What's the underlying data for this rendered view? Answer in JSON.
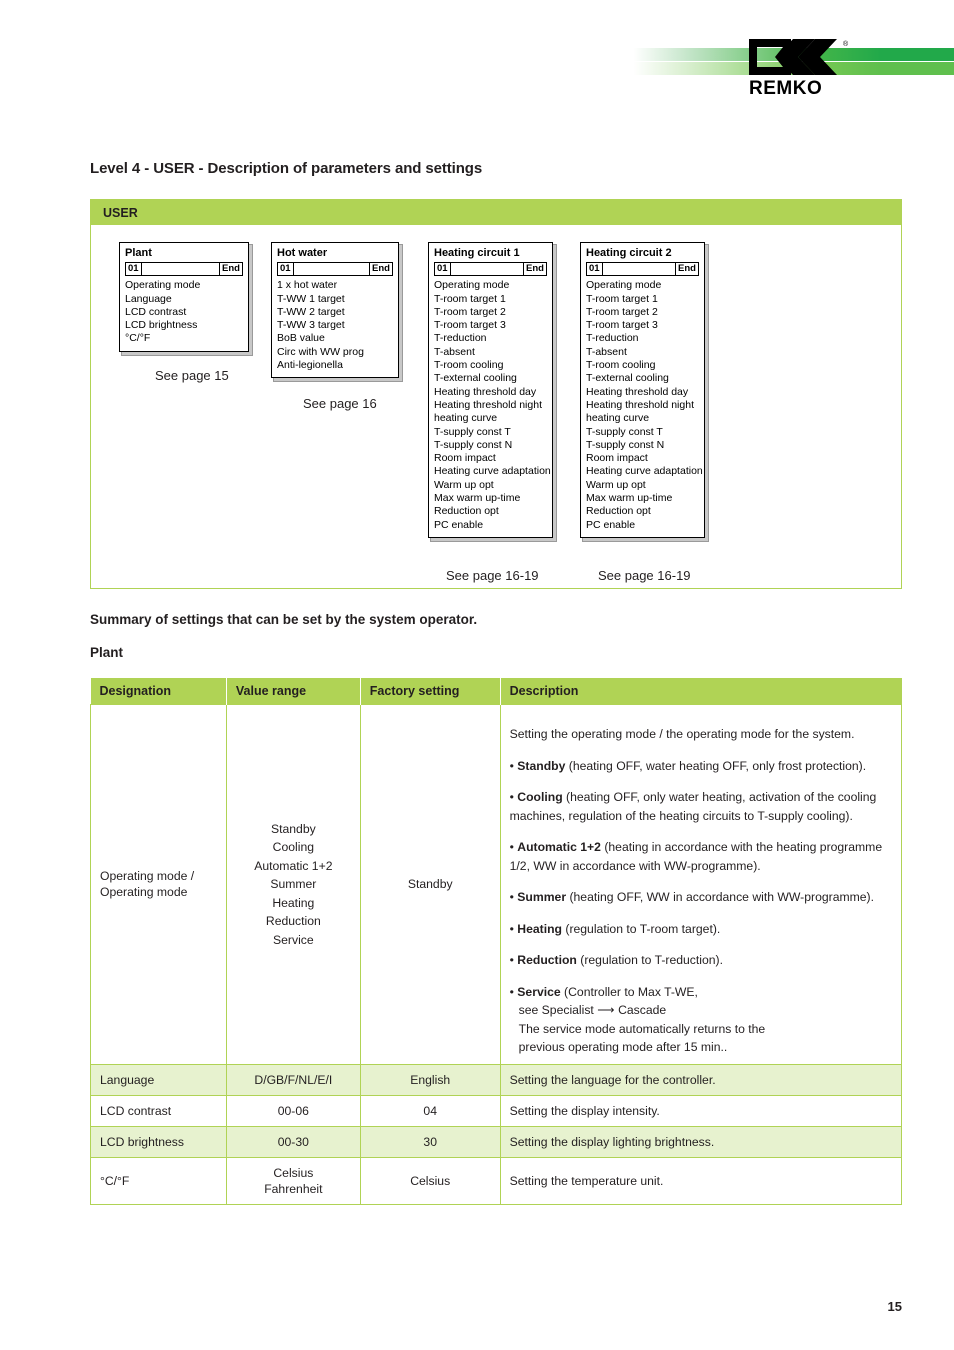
{
  "brand": {
    "name": "REMKO",
    "registered": "®",
    "accent_green": "#b0d355",
    "bar_green_dark": "#22a94a",
    "bar_green_light": "#5fbf4d"
  },
  "section": {
    "title": "Level 4 - USER - Description of parameters and settings"
  },
  "diagram": {
    "panel_label": "USER",
    "boxes": [
      {
        "title": "Plant",
        "index": "01",
        "end": "End",
        "items": [
          "Operating mode",
          "Language",
          "LCD contrast",
          "LCD brightness",
          "°C/°F"
        ],
        "caption": "See page 15"
      },
      {
        "title": "Hot water",
        "index": "01",
        "end": "End",
        "items": [
          "1 x hot water",
          "T-WW 1 target",
          "T-WW 2 target",
          "T-WW 3 target",
          "BoB value",
          "Circ with WW prog",
          "Anti-legionella"
        ],
        "caption": "See page 16"
      },
      {
        "title": "Heating circuit 1",
        "index": "01",
        "end": "End",
        "items": [
          "Operating mode",
          "T-room target 1",
          "T-room target 2",
          "T-room target 3",
          "T-reduction",
          "T-absent",
          "T-room cooling",
          "T-external cooling",
          "Heating threshold day",
          "Heating threshold night",
          "heating curve",
          "T-supply const T",
          "T-supply const N",
          "Room impact",
          "Heating curve adaptation",
          "Warm up opt",
          "Max warm up-time",
          "Reduction opt",
          "PC enable"
        ],
        "caption": "See page 16-19"
      },
      {
        "title": "Heating circuit 2",
        "index": "01",
        "end": "End",
        "items": [
          "Operating mode",
          "T-room target 1",
          "T-room target 2",
          "T-room target 3",
          "T-reduction",
          "T-absent",
          "T-room cooling",
          "T-external cooling",
          "Heating threshold day",
          "Heating threshold night",
          "heating curve",
          "T-supply const T",
          "T-supply const N",
          "Room impact",
          "Heating curve adaptation",
          "Warm up opt",
          "Max warm up-time",
          "Reduction opt",
          "PC enable"
        ],
        "caption": "See page 16-19"
      }
    ]
  },
  "summary_line": "Summary of settings that can be set by the system operator.",
  "plant_line": "Plant",
  "table": {
    "headers": {
      "designation": "Designation",
      "value_range": "Value range",
      "factory_setting": "Factory setting",
      "description": "Description"
    },
    "operating_mode_row": {
      "designation": "Operating mode /\nOperating mode",
      "designation_l1": "Operating mode /",
      "designation_l2": "Operating mode",
      "value_range": [
        "Standby",
        "Cooling",
        "Automatic 1+2",
        "Summer",
        "Heating",
        "Reduction",
        "Service"
      ],
      "factory_setting": "Standby",
      "description": {
        "intro": "Setting the operating mode / the operating mode for the system.",
        "bullets": [
          {
            "bullet": "•",
            "term": "Standby",
            "text": " (heating OFF, water heating OFF, only frost protection)."
          },
          {
            "bullet": "•",
            "term": "Cooling",
            "text": " (heating OFF, only water heating, activation of the cooling machines, regulation of the heating circuits to T-supply cooling)."
          },
          {
            "bullet": "•",
            "term": "Automatic 1+2",
            "text": " (heating in accordance with the heating programme 1/2, WW in accordance with WW-programme)."
          },
          {
            "bullet": "•",
            "term": "Summer",
            "text": " (heating OFF, WW in accordance with WW-programme)."
          },
          {
            "bullet": "•",
            "term": "Heating",
            "text": " (regulation to T-room target)."
          },
          {
            "bullet": "•",
            "term": "Reduction",
            "text": " (regulation to T-reduction)."
          },
          {
            "bullet": "•",
            "term": "Service",
            "text": " (Controller to Max T-WE,",
            "line2_pre": "see Specialist ",
            "line2_arrow": "⟶",
            "line2_post": " Cascade",
            "line3": "The service mode automatically returns to the",
            "line4": "previous operating mode after 15 min.."
          }
        ]
      }
    },
    "rows": [
      {
        "designation": "Language",
        "value_range": "D/GB/F/NL/E/I",
        "factory_setting": "English",
        "description": "Setting the language for the controller.",
        "shaded": true
      },
      {
        "designation": "LCD contrast",
        "value_range": "00-06",
        "factory_setting": "04",
        "description": "Setting the display intensity.",
        "shaded": false
      },
      {
        "designation": "LCD brightness",
        "value_range": "00-30",
        "factory_setting": "30",
        "description": "Setting the display lighting brightness.",
        "shaded": true
      },
      {
        "designation": "°C/°F",
        "value_range": "Celsius\nFahrenheit",
        "value_range_l1": "Celsius",
        "value_range_l2": "Fahrenheit",
        "factory_setting": "Celsius",
        "description": "Setting the temperature unit.",
        "shaded": false
      }
    ]
  },
  "page_number": "15"
}
